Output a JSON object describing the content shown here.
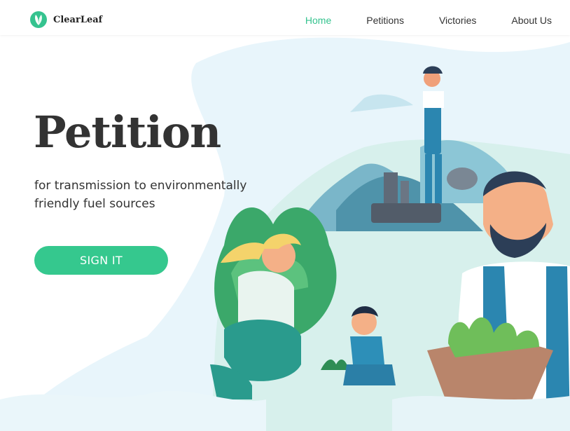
{
  "brand": {
    "name": "ClearLeaf",
    "accent": "#35c38f"
  },
  "nav": {
    "items": [
      {
        "label": "Home",
        "active": true
      },
      {
        "label": "Petitions",
        "active": false
      },
      {
        "label": "Victories",
        "active": false
      },
      {
        "label": "About Us",
        "active": false
      }
    ]
  },
  "hero": {
    "title": "Petition",
    "subtitle": "for transmission to environmentally friendly fuel sources",
    "button_label": "SIGN IT"
  }
}
